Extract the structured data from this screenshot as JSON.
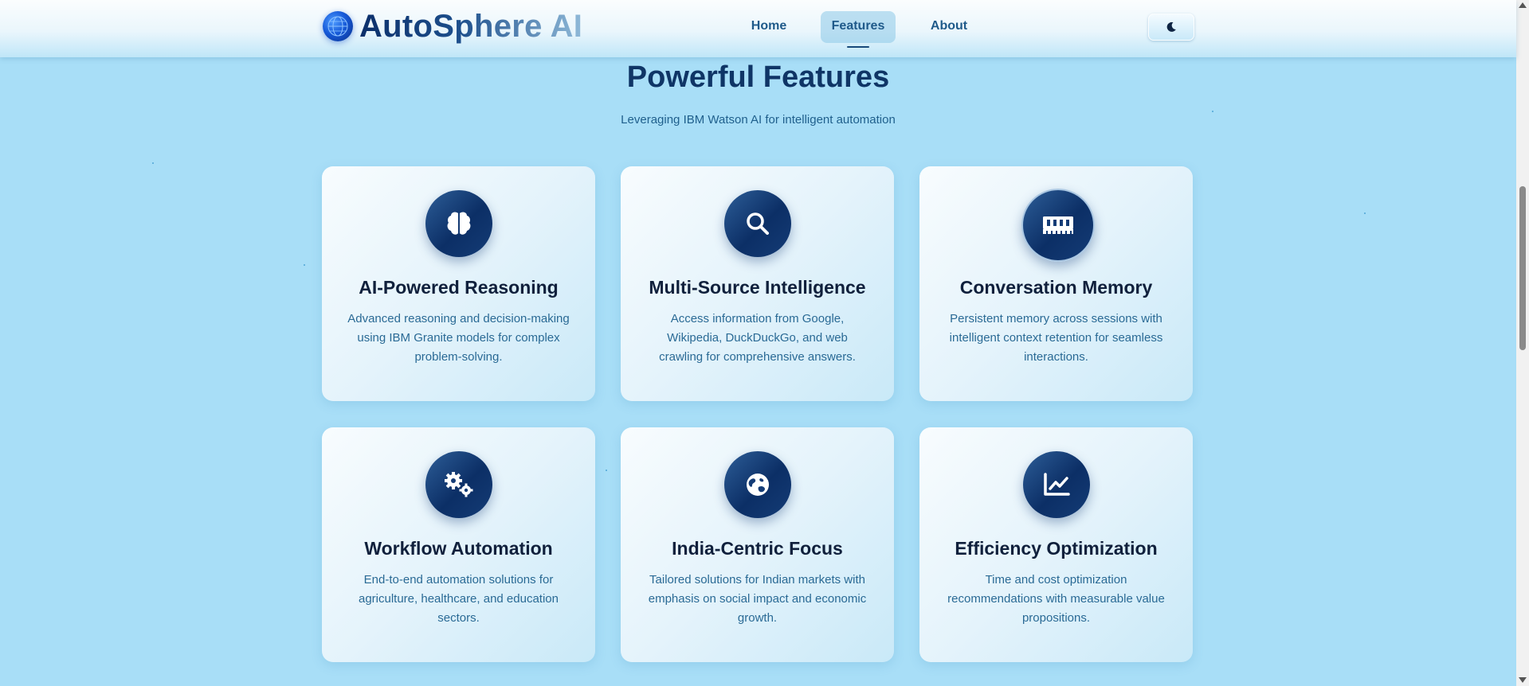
{
  "brand": {
    "name": "AutoSphere AI",
    "logo_icon": "globe-icon"
  },
  "nav": {
    "links": [
      {
        "label": "Home",
        "active": false
      },
      {
        "label": "Features",
        "active": true
      },
      {
        "label": "About",
        "active": false
      }
    ],
    "theme_toggle_icon": "moon-icon"
  },
  "section": {
    "title": "Powerful Features",
    "subtitle": "Leveraging IBM Watson AI for intelligent automation"
  },
  "features": [
    {
      "icon": "brain-icon",
      "title": "AI-Powered Reasoning",
      "description": "Advanced reasoning and decision-making using IBM Granite models for complex problem-solving."
    },
    {
      "icon": "search-icon",
      "title": "Multi-Source Intelligence",
      "description": "Access information from Google, Wikipedia, DuckDuckGo, and web crawling for comprehensive answers."
    },
    {
      "icon": "memory-icon",
      "title": "Conversation Memory",
      "description": "Persistent memory across sessions with intelligent context retention for seamless interactions."
    },
    {
      "icon": "gears-icon",
      "title": "Workflow Automation",
      "description": "End-to-end automation solutions for agriculture, healthcare, and education sectors."
    },
    {
      "icon": "globe-icon",
      "title": "India-Centric Focus",
      "description": "Tailored solutions for Indian markets with emphasis on social impact and economic growth."
    },
    {
      "icon": "chart-line-icon",
      "title": "Efficiency Optimization",
      "description": "Time and cost optimization recommendations with measurable value propositions."
    }
  ],
  "colors": {
    "background": "#a8def7",
    "heading": "#0f3566",
    "icon_bg": "#0c2f66",
    "text": "#2a6a95"
  }
}
